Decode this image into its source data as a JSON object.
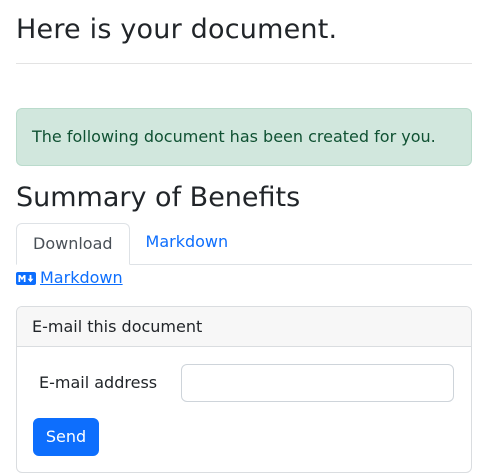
{
  "header": {
    "title": "Here is your document."
  },
  "alert": {
    "message": "The following document has been created for you."
  },
  "document": {
    "title": "Summary of Benefits"
  },
  "tabs": [
    {
      "label": "Download",
      "active": true
    },
    {
      "label": "Markdown",
      "active": false
    }
  ],
  "download": {
    "markdown_link_label": "Markdown",
    "icon": "markdown-icon"
  },
  "email_card": {
    "header": "E-mail this document",
    "field_label": "E-mail address",
    "field_value": "",
    "send_label": "Send"
  },
  "colors": {
    "primary": "#0d6efd",
    "alert_bg": "#d1e7dd",
    "alert_text": "#0f5132"
  }
}
